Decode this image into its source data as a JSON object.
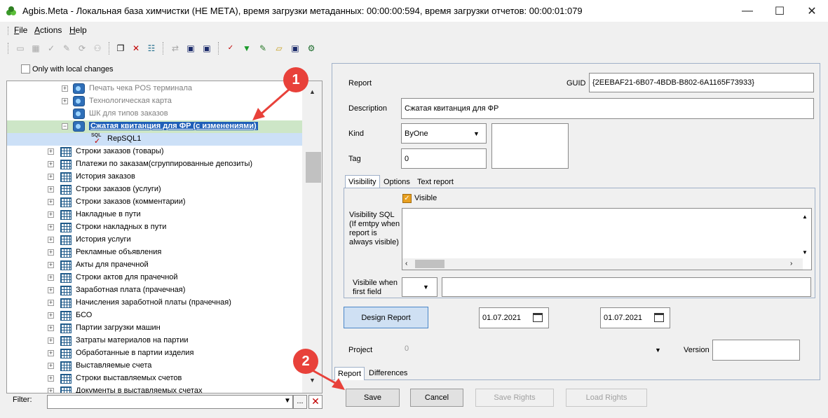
{
  "window": {
    "title": "Agbis.Meta - Локальная база химчистки (НЕ МЕТА), время загрузки метаданных: 00:00:00:594, время загрузки отчетов: 00:00:01:079",
    "controls": {
      "minimize": "—",
      "maximize": "☐",
      "close": "✕"
    }
  },
  "menu": [
    "File",
    "Actions",
    "Help"
  ],
  "left": {
    "only_local_label": "Only with local changes",
    "tree": [
      {
        "label": "Печать чека POS терминала",
        "icon": "report-icon",
        "expand": "+",
        "faded": true
      },
      {
        "label": "Технологическая карта",
        "icon": "report-icon",
        "expand": "+",
        "faded": true
      },
      {
        "label": "ШК для типов заказов",
        "icon": "report-icon",
        "expand": "",
        "faded": true
      },
      {
        "label": "Сжатая квитанция для ФР (с изменениями)",
        "icon": "report-icon",
        "expand": "−",
        "selected": "green"
      },
      {
        "label": "RepSQL1",
        "icon": "sql-icon",
        "expand": "",
        "selected": "blue"
      },
      {
        "label": "Строки заказов (товары)",
        "icon": "table-icon",
        "expand": "+"
      },
      {
        "label": "Платежи по заказам(сгруппированные депозиты)",
        "icon": "table-icon",
        "expand": "+"
      },
      {
        "label": "История заказов",
        "icon": "table-icon",
        "expand": "+"
      },
      {
        "label": "Строки заказов (услуги)",
        "icon": "table-icon",
        "expand": "+"
      },
      {
        "label": "Строки заказов (комментарии)",
        "icon": "table-icon",
        "expand": "+"
      },
      {
        "label": "Накладные в пути",
        "icon": "table-icon",
        "expand": "+"
      },
      {
        "label": "Строки накладных в пути",
        "icon": "table-icon",
        "expand": "+"
      },
      {
        "label": "История услуги",
        "icon": "table-icon",
        "expand": "+"
      },
      {
        "label": "Рекламные объявления",
        "icon": "table-icon",
        "expand": "+"
      },
      {
        "label": "Акты для прачечной",
        "icon": "table-icon",
        "expand": "+"
      },
      {
        "label": "Строки актов для прачечной",
        "icon": "table-icon",
        "expand": "+"
      },
      {
        "label": "Заработная плата (прачечная)",
        "icon": "table-icon",
        "expand": "+"
      },
      {
        "label": "Начисления заработной платы (прачечная)",
        "icon": "table-icon",
        "expand": "+"
      },
      {
        "label": "БСО",
        "icon": "table-icon",
        "expand": "+"
      },
      {
        "label": "Партии загрузки машин",
        "icon": "table-icon",
        "expand": "+"
      },
      {
        "label": "Затраты материалов на партии",
        "icon": "table-icon",
        "expand": "+"
      },
      {
        "label": "Обработанные в партии изделия",
        "icon": "table-icon",
        "expand": "+"
      },
      {
        "label": "Выставляемые счета",
        "icon": "table-icon",
        "expand": "+"
      },
      {
        "label": "Строки выставляемых счетов",
        "icon": "table-icon",
        "expand": "+"
      },
      {
        "label": "Документы в выставляемых счетах",
        "icon": "table-icon",
        "expand": "+"
      }
    ],
    "filter_label": "Filter:",
    "filter_value": "",
    "filter_dots": "..."
  },
  "report": {
    "report_label": "Report",
    "guid_label": "GUID",
    "guid_value": "{2EEBAF21-6B07-4BDB-B802-6A1165F73933}",
    "description_label": "Description",
    "description_value": "Сжатая квитанция для ФР",
    "kind_label": "Kind",
    "kind_value": "ByOne",
    "tag_label": "Tag",
    "tag_value": "0",
    "tabs": [
      "Visibility",
      "Options",
      "Text report"
    ],
    "visible_label": "Visible",
    "visibility_sql_label": "Visibility SQL (If emtpy when report is always visible)",
    "visible_when_label": "Visibile when first field",
    "design_report_label": "Design Report",
    "date1": "01.07.2021",
    "date2": "01.07.2021",
    "project_label": "Project",
    "project_value": "0",
    "version_label": "Version",
    "version_value": "",
    "bottom_tabs": [
      "Report",
      "Differences"
    ]
  },
  "buttons": {
    "save": "Save",
    "cancel": "Cancel",
    "save_rights": "Save Rights",
    "load_rights": "Load Rights"
  },
  "annotations": [
    "1",
    "2"
  ],
  "colors": {
    "annotation": "#e8413a",
    "selection_green": "#cde6c7",
    "selection_blue": "#cce0f7",
    "accent": "#4a86c8"
  }
}
